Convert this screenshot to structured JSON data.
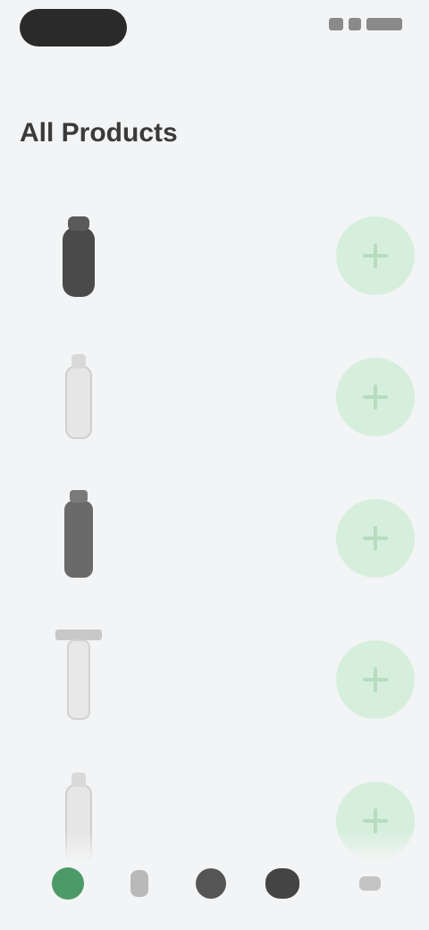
{
  "status_bar": {
    "time": ""
  },
  "header": {
    "title": "All Products"
  },
  "products": [
    {
      "title": "",
      "subtitle": "",
      "icon": "dark-bottle-icon"
    },
    {
      "title": "",
      "subtitle": "",
      "icon": "light-bottle-icon"
    },
    {
      "title": "",
      "subtitle": "",
      "icon": "dark-tube-icon"
    },
    {
      "title": "",
      "subtitle": "",
      "icon": "light-dropper-icon"
    },
    {
      "title": "",
      "subtitle": "",
      "icon": "light-bottle-icon"
    }
  ],
  "nav": {
    "items": [
      {
        "icon": "home-icon"
      },
      {
        "icon": "search-icon"
      },
      {
        "icon": "cart-icon"
      },
      {
        "icon": "profile-icon"
      },
      {
        "icon": "more-icon"
      }
    ]
  },
  "colors": {
    "accent": "#2e8a4f",
    "add_button_bg": "#d6efdc",
    "background": "#f3f4f5"
  }
}
